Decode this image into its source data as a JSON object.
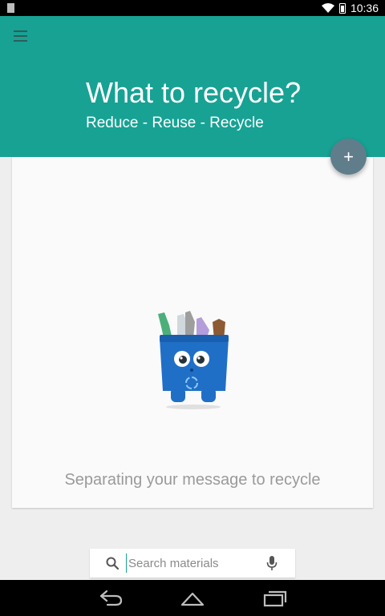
{
  "status_bar": {
    "time": "10:36"
  },
  "header": {
    "title": "What to recycle?",
    "subtitle": "Reduce - Reuse - Recycle"
  },
  "fab": {
    "glyph": "+"
  },
  "card": {
    "message": "Separating your message to recycle"
  },
  "search": {
    "placeholder": "Search materials",
    "value": ""
  },
  "icons": [
    "menu-icon",
    "wifi-icon",
    "battery-icon",
    "add-icon",
    "recycle-bin-mascot",
    "search-icon",
    "microphone-icon",
    "back-icon",
    "home-icon",
    "recent-apps-icon"
  ],
  "colors": {
    "app_bar": "#17a294",
    "fab": "#607d8b",
    "mascot_blue": "#1f6fc7"
  }
}
